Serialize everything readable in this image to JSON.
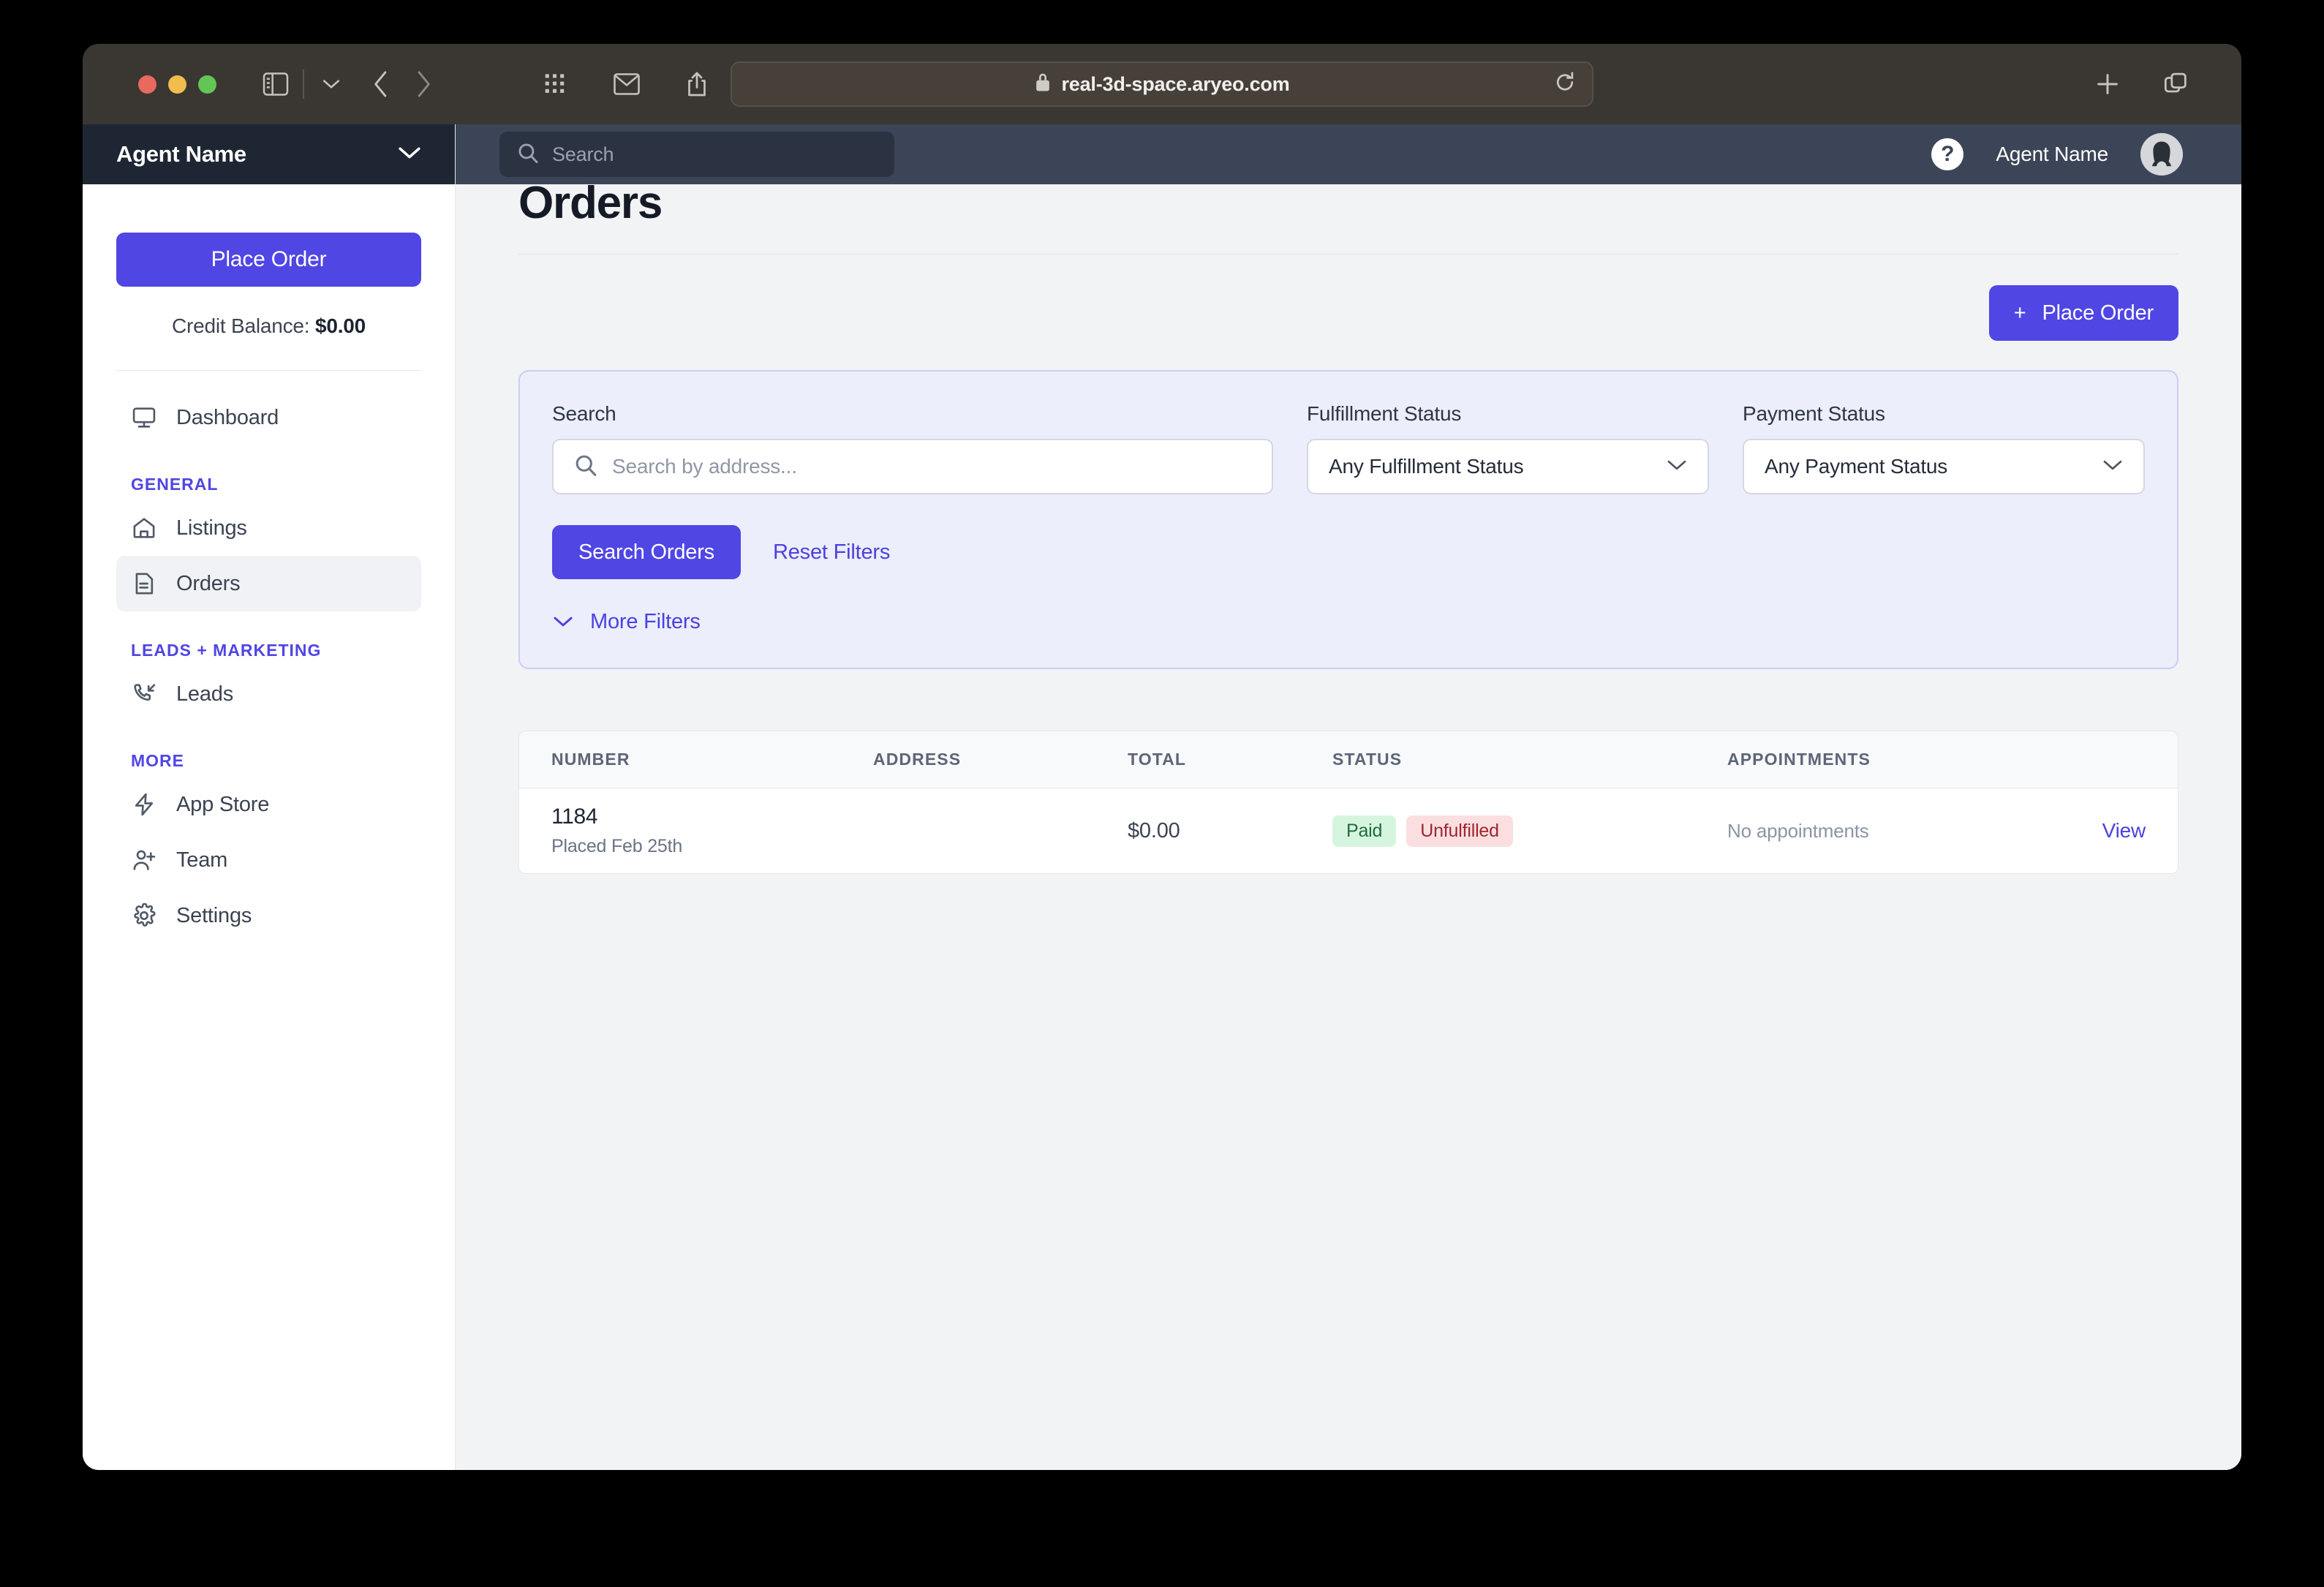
{
  "browser": {
    "url": "real-3d-space.aryeo.com",
    "lock_icon": "lock-icon",
    "reload_icon": "reload-icon",
    "new_tab_icon": "plus-icon",
    "tab_overview_icon": "tab-overview-icon",
    "sidebar_toggle_icon": "sidebar-toggle-icon",
    "back_icon": "chevron-left-icon",
    "forward_icon": "chevron-right-icon",
    "grid_icon": "apps-grid-icon",
    "mail_icon": "mail-icon",
    "share_icon": "share-icon",
    "privacy_icon": "shield-icon"
  },
  "sidebar": {
    "account_name": "Agent Name",
    "place_order_label": "Place Order",
    "credit_label": "Credit Balance: ",
    "credit_value": "$0.00",
    "items": [
      {
        "label": "Dashboard",
        "icon": "monitor-icon",
        "active": false
      },
      {
        "label": "Listings",
        "icon": "house-icon",
        "active": false
      },
      {
        "label": "Orders",
        "icon": "document-icon",
        "active": true
      },
      {
        "label": "Leads",
        "icon": "phone-incoming-icon",
        "active": false
      },
      {
        "label": "App Store",
        "icon": "lightning-icon",
        "active": false
      },
      {
        "label": "Team",
        "icon": "user-plus-icon",
        "active": false
      },
      {
        "label": "Settings",
        "icon": "gear-icon",
        "active": false
      }
    ],
    "sections": {
      "general": "GENERAL",
      "leads_marketing": "LEADS + MARKETING",
      "more": "MORE"
    }
  },
  "header": {
    "search_placeholder": "Search",
    "help_glyph": "?",
    "user_name": "Agent Name"
  },
  "main": {
    "page_title": "Orders",
    "place_order_label": "Place Order",
    "place_order_plus": "+"
  },
  "filters": {
    "search_label": "Search",
    "search_placeholder": "Search by address...",
    "search_value": "",
    "fulfillment_label": "Fulfillment Status",
    "fulfillment_value": "Any Fulfillment Status",
    "payment_label": "Payment Status",
    "payment_value": "Any Payment Status",
    "search_button": "Search Orders",
    "reset_link": "Reset Filters",
    "more_filters": "More Filters"
  },
  "table": {
    "columns": [
      "NUMBER",
      "ADDRESS",
      "TOTAL",
      "STATUS",
      "APPOINTMENTS"
    ],
    "rows": [
      {
        "number": "1184",
        "placed": "Placed Feb 25th",
        "address": "",
        "total": "$0.00",
        "status_badges": [
          {
            "label": "Paid",
            "kind": "paid"
          },
          {
            "label": "Unfulfilled",
            "kind": "unfulfilled"
          }
        ],
        "appointments": "No appointments",
        "action": "View"
      }
    ]
  },
  "colors": {
    "accent": "#5046e4",
    "sidebar_header": "#1f2633",
    "app_header": "#3c4458",
    "paid_bg": "#d6f5df",
    "unfulfilled_bg": "#fbdfe0"
  }
}
